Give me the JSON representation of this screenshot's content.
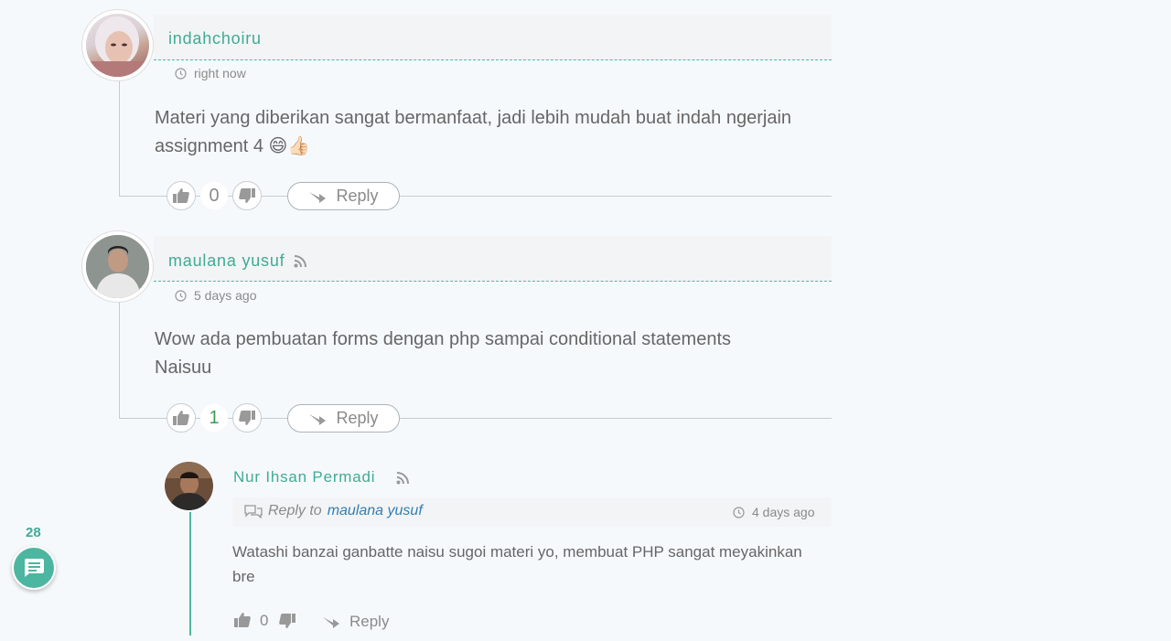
{
  "comments": [
    {
      "author": "indahchoiru",
      "time": "right now",
      "text_line1": "Materi yang diberikan sangat bermanfaat, jadi lebih mudah buat indah ngerjain",
      "text_line2": "assignment 4 😄👍🏻",
      "votes": "0",
      "reply_label": "Reply"
    },
    {
      "author": "maulana yusuf",
      "time": "5 days ago",
      "text_line1": "Wow ada pembuatan forms dengan php sampai conditional statements",
      "text_line2": "Naisuu",
      "votes": "1",
      "reply_label": "Reply"
    }
  ],
  "reply": {
    "author": "Nur Ihsan Permadi",
    "reply_to_prefix": "Reply to",
    "reply_to_name": "maulana yusuf",
    "time": "4 days ago",
    "text_line1": "Watashi banzai ganbatte naisu sugoi materi yo, membuat PHP sangat meyakinkan",
    "text_line2": "bre",
    "votes": "0",
    "reply_label": "Reply"
  },
  "fab": {
    "count": "28",
    "icon": "comment-icon"
  },
  "colors": {
    "accent": "#3fab96",
    "positive": "#3f9a55"
  }
}
